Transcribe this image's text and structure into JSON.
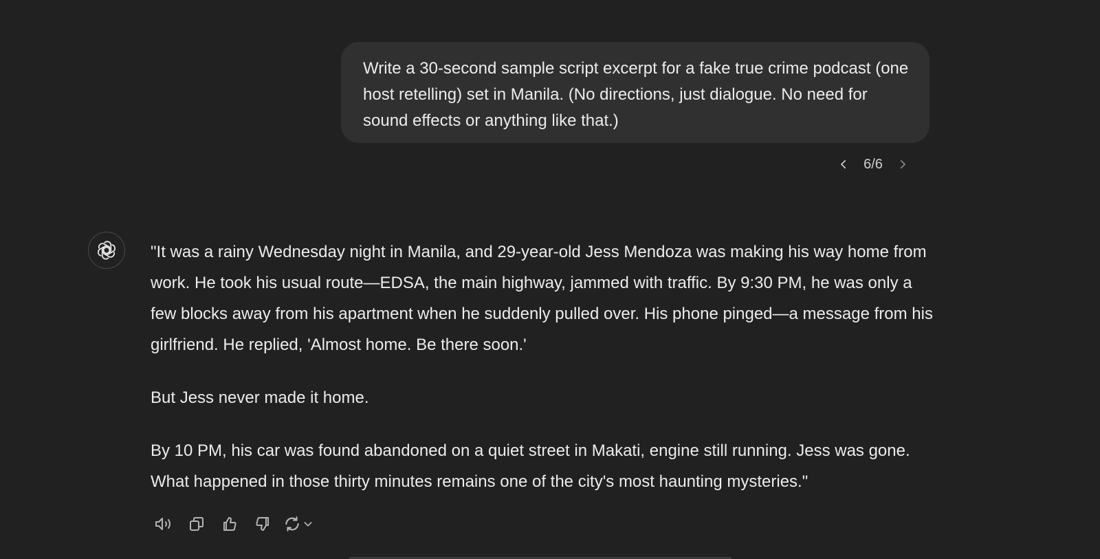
{
  "conversation": {
    "user_message": "Write a 30-second sample script excerpt for a fake true crime podcast (one host retelling) set in Manila. (No directions, just dialogue. No need for sound effects or anything like that.)",
    "pager": {
      "count": "6/6",
      "prev_icon": "chevron-left-icon",
      "next_icon": "chevron-right-icon"
    },
    "assistant": {
      "avatar_icon": "openai-logo-icon",
      "paragraphs": [
        "\"It was a rainy Wednesday night in Manila, and 29-year-old Jess Mendoza was making his way home from work. He took his usual route—EDSA, the main highway, jammed with traffic. By 9:30 PM, he was only a few blocks away from his apartment when he suddenly pulled over. His phone pinged—a message from his girlfriend. He replied, 'Almost home. Be there soon.'",
        "But Jess never made it home.",
        "By 10 PM, his car was found abandoned on a quiet street in Makati, engine still running. Jess was gone. What happened in those thirty minutes remains one of the city's most haunting mysteries.\""
      ]
    },
    "actions": {
      "icons": [
        "speaker-icon",
        "copy-icon",
        "thumbs-up-icon",
        "thumbs-down-icon",
        "regenerate-icon",
        "chevron-down-icon"
      ]
    }
  },
  "colors": {
    "background": "#212121",
    "user_bubble": "#303030",
    "text": "#ececec",
    "muted": "#b4b4b4"
  }
}
